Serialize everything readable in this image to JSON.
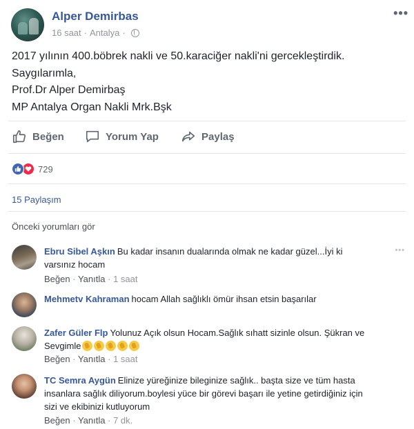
{
  "post": {
    "author": "Alper Demirbas",
    "time": "16 saat",
    "separator": "·",
    "location": "Antalya",
    "more_label": "•••",
    "lines": [
      "2017 yılının 400.böbrek nakli ve 50.karaciğer nakli'ni gercekleştirdik.",
      "Saygılarımla,",
      "Prof.Dr Alper Demirbaş",
      "MP Antalya Organ Nakli Mrk.Bşk"
    ]
  },
  "actions": {
    "like": "Beğen",
    "comment": "Yorum Yap",
    "share": "Paylaş"
  },
  "reactions": {
    "count": "729",
    "types": [
      "like-icon",
      "love-icon"
    ]
  },
  "shares": "15 Paylaşım",
  "previous_comments": "Önceki yorumları gör",
  "comment_actions": {
    "like": "Beğen",
    "reply": "Yanıtla",
    "dot": "·"
  },
  "comments": [
    {
      "name": "Ebru Sibel Aşkın",
      "text_lines": [
        "Bu kadar insanın dualarında olmak ne kadar güzel...İyi ki",
        "varsınız hocam"
      ],
      "time": "1 saat",
      "more_label": "•••"
    },
    {
      "name": "Mehmetv Kahraman",
      "text_lines": [
        "hocam Allah sağlıklı ömür ihsan etsin başarılar"
      ],
      "time": ""
    },
    {
      "name": "Zafer Güler Flp",
      "text_lines": [
        "Yolunuz Açık olsun Hocam.Sağlık sıhatt sizinle olsun. Şükran ve",
        "Sevgimle"
      ],
      "emoji": [
        "clapping-hands-icon",
        "clapping-hands-icon",
        "clapping-hands-icon",
        "clapping-hands-icon",
        "clapping-hands-icon"
      ],
      "time": "1 saat"
    },
    {
      "name": "TC Semra Aygün",
      "text_lines": [
        "Elinize yüreğinize bileginize sağlık.. başta size ve tüm hasta",
        "insanlara sağlık diliyorum.boylesi yüce bir görevi başarı ile yetine getirdiğiniz için",
        "sizi ve ekibinizi kutluyorum"
      ],
      "time": "7 dk."
    }
  ],
  "colors": {
    "link": "#365899",
    "secondary": "#90949c",
    "like_blue": "#4267b2",
    "love_red": "#f0284a"
  }
}
